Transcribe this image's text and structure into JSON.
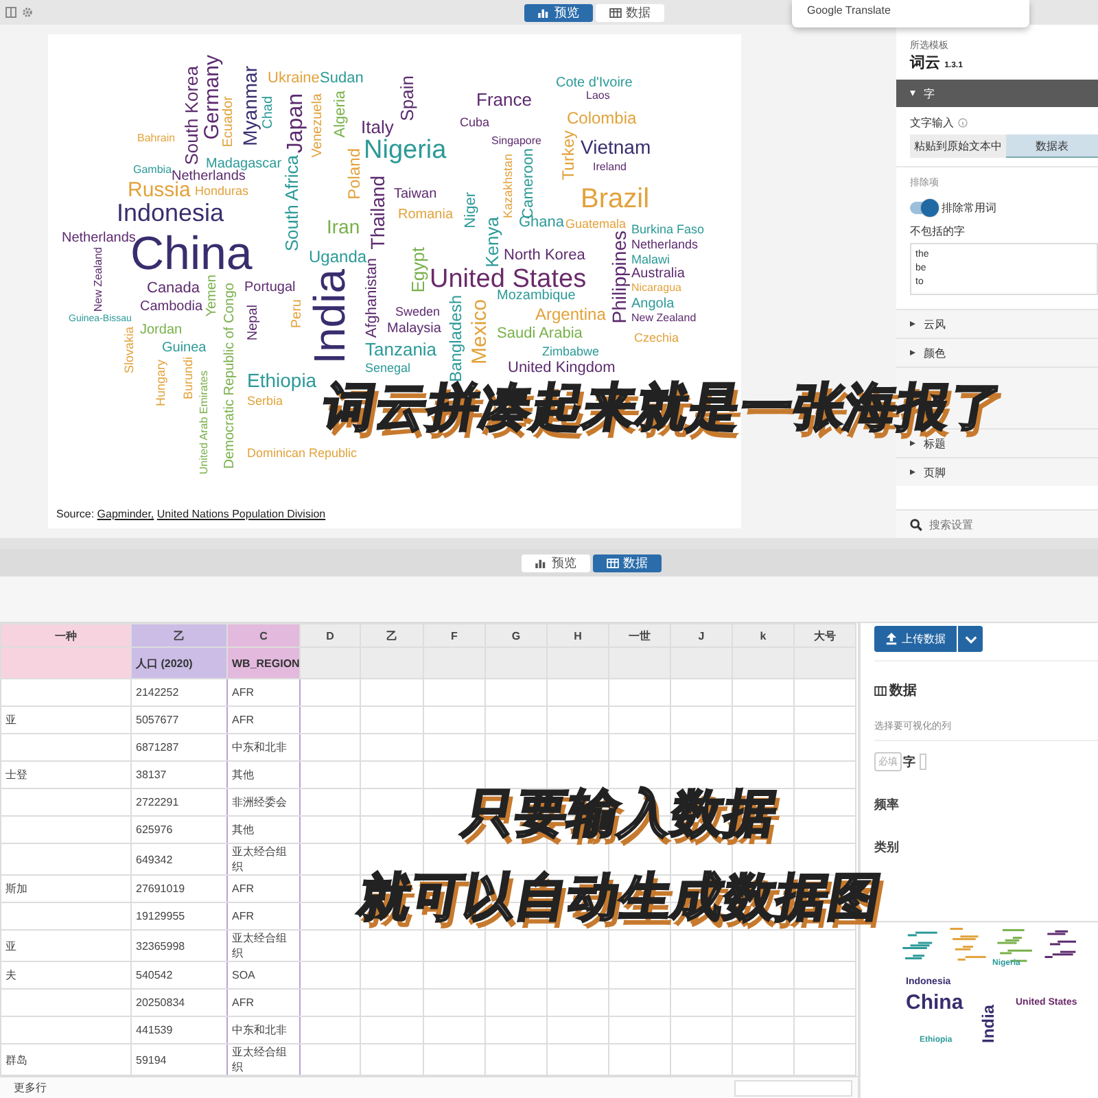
{
  "top": {
    "tabs": [
      {
        "label": "预览",
        "kind": "chart",
        "selected": true
      },
      {
        "label": "数据",
        "kind": "table",
        "selected": false
      }
    ],
    "popup": {
      "label": "Google Translate"
    },
    "cloud": {
      "words": [
        {
          "text": "Germany",
          "color": "#5c2a6e"
        },
        {
          "text": "South Korea",
          "color": "#5c2a6e"
        },
        {
          "text": "Myanmar",
          "color": "#3a2d6e"
        },
        {
          "text": "Ukraine",
          "color": "#e2a23b"
        },
        {
          "text": "Sudan",
          "color": "#2b9a98"
        },
        {
          "text": "Spain",
          "color": "#5c2a6e"
        },
        {
          "text": "Cote d'Ivoire",
          "color": "#2b9a98"
        },
        {
          "text": "France",
          "color": "#5c2a6e"
        },
        {
          "text": "Algeria",
          "color": "#79b04a"
        },
        {
          "text": "Laos",
          "color": "#5c2a6e"
        },
        {
          "text": "Japan",
          "color": "#5c2a6e"
        },
        {
          "text": "Venezuela",
          "color": "#e2a23b"
        },
        {
          "text": "Ecuador",
          "color": "#e2a23b"
        },
        {
          "text": "Chad",
          "color": "#2b9a98"
        },
        {
          "text": "Italy",
          "color": "#5c2a6e"
        },
        {
          "text": "Cuba",
          "color": "#5c2a6e"
        },
        {
          "text": "Colombia",
          "color": "#e2a23b"
        },
        {
          "text": "Bahrain",
          "color": "#e2a23b"
        },
        {
          "text": "Turkey",
          "color": "#e2a23b"
        },
        {
          "text": "Nigeria",
          "color": "#2b9a98"
        },
        {
          "text": "Singapore",
          "color": "#5c2a6e"
        },
        {
          "text": "Vietnam",
          "color": "#3a2d6e"
        },
        {
          "text": "Poland",
          "color": "#e2a23b"
        },
        {
          "text": "Cameroon",
          "color": "#2b9a98"
        },
        {
          "text": "Kazakhstan",
          "color": "#e2a23b"
        },
        {
          "text": "Gambia",
          "color": "#2b9a98"
        },
        {
          "text": "Madagascar",
          "color": "#2b9a98"
        },
        {
          "text": "South Africa",
          "color": "#2b9a98"
        },
        {
          "text": "Ireland",
          "color": "#5c2a6e"
        },
        {
          "text": "Netherlands",
          "color": "#5c2a6e"
        },
        {
          "text": "Thailand",
          "color": "#5c2a6e"
        },
        {
          "text": "Russia",
          "color": "#e2a23b"
        },
        {
          "text": "Honduras",
          "color": "#e2a23b"
        },
        {
          "text": "Taiwan",
          "color": "#5c2a6e"
        },
        {
          "text": "Niger",
          "color": "#2b9a98"
        },
        {
          "text": "Indonesia",
          "color": "#3a2d6e"
        },
        {
          "text": "Brazil",
          "color": "#e2a23b"
        },
        {
          "text": "Iran",
          "color": "#79b04a"
        },
        {
          "text": "Romania",
          "color": "#e2a23b"
        },
        {
          "text": "Ghana",
          "color": "#2b9a98"
        },
        {
          "text": "Kenya",
          "color": "#2b9a98"
        },
        {
          "text": "Guatemala",
          "color": "#e2a23b"
        },
        {
          "text": "Burkina Faso",
          "color": "#2b9a98"
        },
        {
          "text": "Netherlands",
          "color": "#5c2a6e"
        },
        {
          "text": "China",
          "color": "#3a2d6e"
        },
        {
          "text": "Philippines",
          "color": "#5c2a6e"
        },
        {
          "text": "Netherlands",
          "color": "#5c2a6e"
        },
        {
          "text": "New Zealand",
          "color": "#5c2a6e"
        },
        {
          "text": "Egypt",
          "color": "#79b04a"
        },
        {
          "text": "Uganda",
          "color": "#2b9a98"
        },
        {
          "text": "North Korea",
          "color": "#5c2a6e"
        },
        {
          "text": "Malawi",
          "color": "#2b9a98"
        },
        {
          "text": "Afghanistan",
          "color": "#5c2a6e"
        },
        {
          "text": "Canada",
          "color": "#5c2a6e"
        },
        {
          "text": "Portugal",
          "color": "#5c2a6e"
        },
        {
          "text": "United States",
          "color": "#6a2a6a"
        },
        {
          "text": "Australia",
          "color": "#5c2a6e"
        },
        {
          "text": "India",
          "color": "#3a2d6e"
        },
        {
          "text": "Yemen",
          "color": "#79b04a"
        },
        {
          "text": "Democratic Republic of Congo",
          "color": "#79b04a"
        },
        {
          "text": "Nicaragua",
          "color": "#e2a23b"
        },
        {
          "text": "Mozambique",
          "color": "#2b9a98"
        },
        {
          "text": "Bangladesh",
          "color": "#2b9a98"
        },
        {
          "text": "Cambodia",
          "color": "#5c2a6e"
        },
        {
          "text": "Guinea-Bissau",
          "color": "#2b9a98"
        },
        {
          "text": "Sweden",
          "color": "#5c2a6e"
        },
        {
          "text": "Argentina",
          "color": "#e2a23b"
        },
        {
          "text": "Angola",
          "color": "#2b9a98"
        },
        {
          "text": "Peru",
          "color": "#e2a23b"
        },
        {
          "text": "Mexico",
          "color": "#e2a23b"
        },
        {
          "text": "Nepal",
          "color": "#5c2a6e"
        },
        {
          "text": "New Zealand",
          "color": "#5c2a6e"
        },
        {
          "text": "Jordan",
          "color": "#79b04a"
        },
        {
          "text": "Malaysia",
          "color": "#5c2a6e"
        },
        {
          "text": "Saudi Arabia",
          "color": "#79b04a"
        },
        {
          "text": "Slovakia",
          "color": "#e2a23b"
        },
        {
          "text": "Czechia",
          "color": "#e2a23b"
        },
        {
          "text": "Guinea",
          "color": "#2b9a98"
        },
        {
          "text": "Tanzania",
          "color": "#2b9a98"
        },
        {
          "text": "Zimbabwe",
          "color": "#2b9a98"
        },
        {
          "text": "Burundi",
          "color": "#e2a23b"
        },
        {
          "text": "Hungary",
          "color": "#e2a23b"
        },
        {
          "text": "Senegal",
          "color": "#2b9a98"
        },
        {
          "text": "United Kingdom",
          "color": "#5c2a6e"
        },
        {
          "text": "United Arab Emirates",
          "color": "#79b04a"
        },
        {
          "text": "Ethiopia",
          "color": "#2b9a98"
        },
        {
          "text": "Serbia",
          "color": "#e2a23b"
        },
        {
          "text": "Dominican Republic",
          "color": "#e2a23b"
        }
      ],
      "source": {
        "label": "Source:",
        "links": [
          "Gapminder,",
          "United Nations Population Division"
        ]
      }
    },
    "settings": {
      "template_label": "所选模板",
      "template_name": "词云",
      "version": "1.3.1",
      "open_section": {
        "label": "字",
        "expanded": true
      },
      "text_input": {
        "label": "文字输入",
        "options": [
          {
            "label": "粘贴到原始文本中",
            "selected": false
          },
          {
            "label": "数据表",
            "selected": true
          }
        ]
      },
      "exclusions_label": "排除项",
      "toggle": {
        "label": "排除常用词",
        "on": true
      },
      "excluded_words": {
        "label": "不包括的字",
        "lines": [
          "the",
          "be",
          "to"
        ]
      },
      "sections": [
        {
          "label": "云风",
          "expanded": false
        },
        {
          "label": "颜色",
          "expanded": false
        },
        {
          "label": "标题",
          "expanded": false
        },
        {
          "label": "页脚",
          "expanded": false
        }
      ],
      "search": {
        "placeholder": "搜索设置"
      }
    }
  },
  "top_caption": "词云拼凑起来就是一张海报了",
  "bottom": {
    "tabs": [
      {
        "label": "预览",
        "kind": "chart",
        "selected": false
      },
      {
        "label": "数据",
        "kind": "table",
        "selected": true
      }
    ],
    "sheet": {
      "columns": [
        {
          "label": "一种",
          "kind": "text"
        },
        {
          "label": "乙",
          "kind": "number",
          "heading": "人口 (2020)"
        },
        {
          "label": "C",
          "kind": "category",
          "heading": "WB_REGION"
        },
        {
          "label": "D"
        },
        {
          "label": "乙"
        },
        {
          "label": "F"
        },
        {
          "label": "G"
        },
        {
          "label": "H"
        },
        {
          "label": "一世"
        },
        {
          "label": "J"
        },
        {
          "label": "k"
        },
        {
          "label": "大号"
        }
      ],
      "rows": [
        {
          "population": "2142252",
          "region": "AFR"
        },
        {
          "name": "亚",
          "population": "5057677",
          "region": "AFR"
        },
        {
          "population": "6871287",
          "region": "中东和北非"
        },
        {
          "name": "士登",
          "population": "38137",
          "region": "其他"
        },
        {
          "population": "2722291",
          "region": "非洲经委会"
        },
        {
          "population": "625976",
          "region": "其他"
        },
        {
          "population": "649342",
          "region": "亚太经合组织"
        },
        {
          "name": "斯加",
          "population": "27691019",
          "region": "AFR"
        },
        {
          "population": "19129955",
          "region": "AFR"
        },
        {
          "name": "亚",
          "population": "32365998",
          "region": "亚太经合组织"
        },
        {
          "name": "夫",
          "population": "540542",
          "region": "SOA"
        },
        {
          "population": "20250834",
          "region": "AFR"
        },
        {
          "population": "441539",
          "region": "中东和北非"
        },
        {
          "name": "群岛",
          "population": "59194",
          "region": "亚太经合组织"
        }
      ],
      "footer": "更多行"
    },
    "panel": {
      "upload_button": "上传数据",
      "heading": "数据",
      "hint": "选择要可视化的列",
      "bindings": [
        {
          "badge": "必填",
          "label": "字"
        }
      ],
      "fields": [
        "频率",
        "类别"
      ],
      "thumbnail": {
        "words": [
          {
            "text": "Nigeria",
            "color": "#2b9a98"
          },
          {
            "text": "Indonesia",
            "color": "#3a2d6e"
          },
          {
            "text": "China",
            "color": "#3a2d6e"
          },
          {
            "text": "United States",
            "color": "#6a2a6a"
          },
          {
            "text": "India",
            "color": "#3a2d6e"
          },
          {
            "text": "Ethiopia",
            "color": "#2b9a98"
          }
        ]
      }
    }
  },
  "bottom_captions": [
    "只要输入数据",
    "就可以自动生成数据图"
  ]
}
